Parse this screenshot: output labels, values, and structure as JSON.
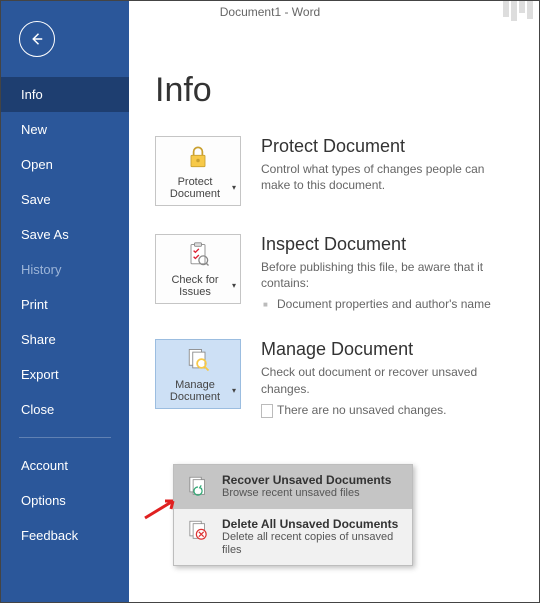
{
  "window": {
    "title": "Document1 - Word"
  },
  "sidebar": {
    "items_top": [
      {
        "label": "Info",
        "name": "info",
        "selected": true
      },
      {
        "label": "New",
        "name": "new"
      },
      {
        "label": "Open",
        "name": "open"
      },
      {
        "label": "Save",
        "name": "save"
      },
      {
        "label": "Save As",
        "name": "save-as"
      },
      {
        "label": "History",
        "name": "history",
        "disabled": true
      },
      {
        "label": "Print",
        "name": "print"
      },
      {
        "label": "Share",
        "name": "share"
      },
      {
        "label": "Export",
        "name": "export"
      },
      {
        "label": "Close",
        "name": "close"
      }
    ],
    "items_bottom": [
      {
        "label": "Account",
        "name": "account"
      },
      {
        "label": "Options",
        "name": "options"
      },
      {
        "label": "Feedback",
        "name": "feedback"
      }
    ]
  },
  "page": {
    "title": "Info"
  },
  "sections": {
    "protect": {
      "button": "Protect Document",
      "heading": "Protect Document",
      "desc": "Control what types of changes people can make to this document."
    },
    "inspect": {
      "button": "Check for Issues",
      "heading": "Inspect Document",
      "desc": "Before publishing this file, be aware that it contains:",
      "bullet": "Document properties and author's name"
    },
    "manage": {
      "button": "Manage Document",
      "heading": "Manage Document",
      "desc": "Check out document or recover unsaved changes.",
      "bullet": "There are no unsaved changes."
    }
  },
  "dropdown": {
    "recover": {
      "title": "Recover Unsaved Documents",
      "sub": "Browse recent unsaved files"
    },
    "delete": {
      "title": "Delete All Unsaved Documents",
      "sub": "Delete all recent copies of unsaved files"
    }
  }
}
